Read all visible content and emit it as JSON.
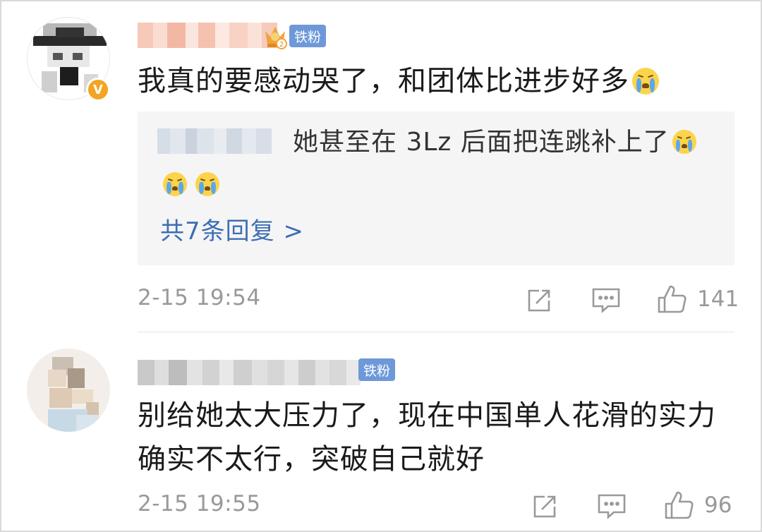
{
  "comments": [
    {
      "badge": "铁粉",
      "text": "我真的要感动哭了，和团体比进步好多",
      "emoji": "crying-emoji",
      "verified_mark": "V",
      "reply_preview": {
        "text": "她甚至在 3Lz 后面把连跳补上了",
        "more_label": "共7条回复 >"
      },
      "timestamp": "2-15 19:54",
      "likes": "141"
    },
    {
      "badge": "铁粉",
      "text_line1": "别给她太大压力了，现在中国单人花滑的实力",
      "text_line2": "确实不太行，突破自己就好",
      "timestamp": "2-15 19:55",
      "likes": "96"
    }
  ],
  "icons": {
    "share": "share-icon",
    "reply": "comment-icon",
    "like": "thumbs-up-icon",
    "crown": "crown-fan-level-icon",
    "verified": "verified-badge-icon"
  },
  "colors": {
    "badge_blue": "#6e99d9",
    "link_blue": "#3d6eb4",
    "meta_gray": "#999999",
    "reply_bg": "#f5f5f5",
    "emoji_yellow": "#fbd44b",
    "verified_orange": "#f3a521"
  }
}
